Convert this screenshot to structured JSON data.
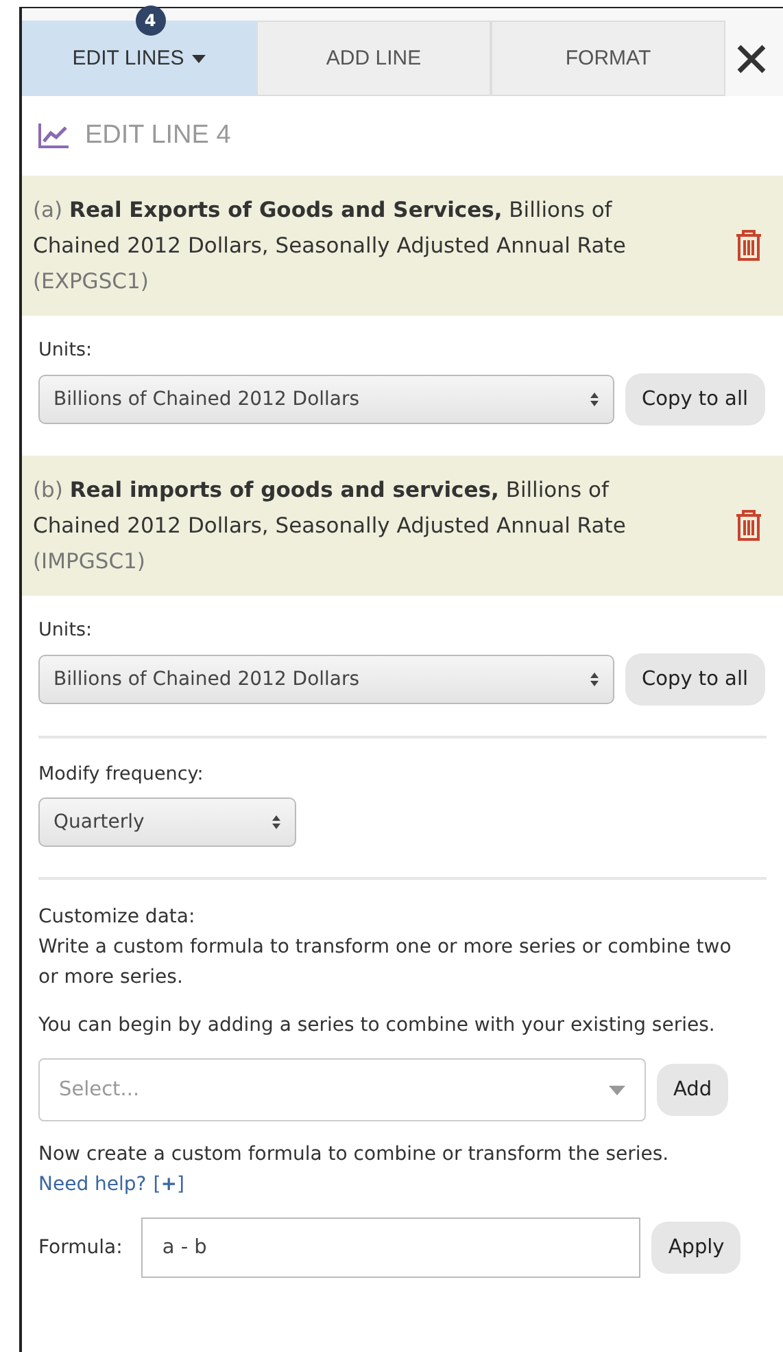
{
  "tabs": [
    {
      "label": "EDIT LINES",
      "badge": "4",
      "dropdown": true,
      "selected": true
    },
    {
      "label": "ADD LINE",
      "dropdown": false,
      "selected": false
    },
    {
      "label": "FORMAT",
      "dropdown": false,
      "selected": false
    }
  ],
  "heading": "EDIT LINE 4",
  "series": [
    {
      "letter": "(a)",
      "name": "Real Exports of Goods and Services,",
      "description": "Billions of Chained 2012 Dollars, Seasonally Adjusted Annual Rate",
      "code": "(EXPGSC1)",
      "units_label": "Units:",
      "units_value": "Billions of Chained 2012 Dollars",
      "copy_button": "Copy to all"
    },
    {
      "letter": "(b)",
      "name": "Real imports of goods and services,",
      "description": "Billions of Chained 2012 Dollars, Seasonally Adjusted Annual Rate",
      "code": "(IMPGSC1)",
      "units_label": "Units:",
      "units_value": "Billions of Chained 2012 Dollars",
      "copy_button": "Copy to all"
    }
  ],
  "frequency": {
    "label": "Modify frequency:",
    "value": "Quarterly"
  },
  "customize": {
    "title": "Customize data:",
    "intro": "Write a custom formula to transform one or more series or combine two or more series.",
    "begin": "You can begin by adding a series to combine with your existing series.",
    "select_placeholder": "Select...",
    "add_button": "Add",
    "instructions": "Now create a custom formula to combine or transform the series.",
    "help_link": "Need help?",
    "expand": "[**+**]",
    "formula_label": "Formula:",
    "formula_value": "a - b",
    "apply_button": "Apply"
  }
}
